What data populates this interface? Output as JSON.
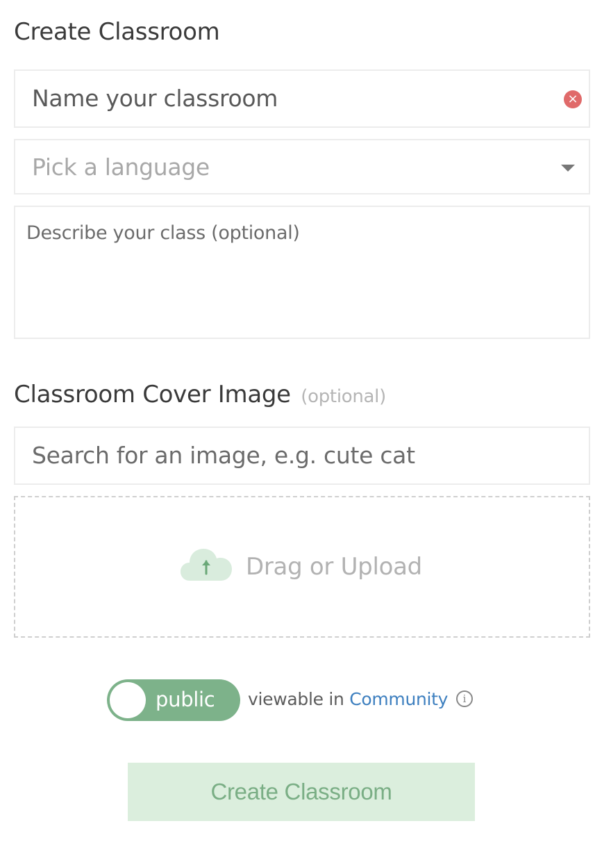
{
  "form": {
    "title": "Create Classroom",
    "name_input": {
      "value": "Name your classroom"
    },
    "language_select": {
      "placeholder": "Pick a language"
    },
    "description_textarea": {
      "placeholder": "Describe your class (optional)"
    },
    "cover_image": {
      "title": "Classroom Cover Image",
      "optional_label": "(optional)",
      "search_placeholder": "Search for an image, e.g. cute cat",
      "dropzone_label": "Drag or Upload"
    },
    "visibility": {
      "toggle_label": "public",
      "toggle_on": true,
      "text": "viewable in",
      "link_text": "Community"
    },
    "submit_label": "Create Classroom"
  },
  "colors": {
    "toggle_bg": "#7db28a",
    "submit_bg": "#dbeedd",
    "submit_text": "#7aae85",
    "clear_icon": "#e06a6a",
    "link": "#3d7fbf"
  },
  "icons": {
    "clear": "close-circle-icon",
    "caret": "chevron-down-icon",
    "upload": "cloud-upload-icon",
    "info": "info-icon"
  }
}
